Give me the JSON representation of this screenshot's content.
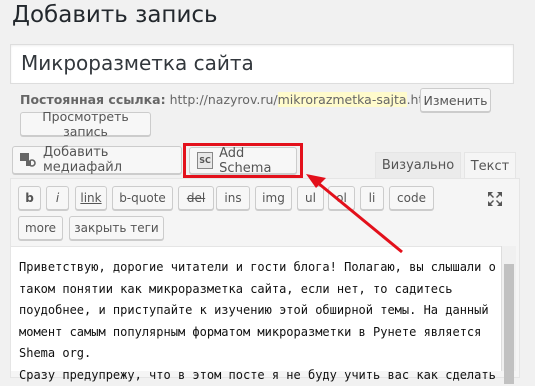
{
  "header": {
    "title": "Добавить запись"
  },
  "post": {
    "title_value": "Микроразметка сайта"
  },
  "permalink": {
    "label": "Постоянная ссылка:",
    "url_prefix": "http://nazyrov.ru/",
    "slug": "mikrorazmetka-sajta",
    "url_suffix": ".html",
    "edit_label": "Изменить",
    "view_label": "Просмотреть запись"
  },
  "media": {
    "add_media_label": "Добавить медиафайл",
    "add_schema_label": "Add Schema"
  },
  "tabs": {
    "visual": "Визуально",
    "text": "Текст"
  },
  "quicktags": [
    "b",
    "i",
    "link",
    "b-quote",
    "del",
    "ins",
    "img",
    "ul",
    "ol",
    "li",
    "code",
    "more",
    "закрыть теги"
  ],
  "editor": {
    "lines": [
      "Приветствую, дорогие читатели и гости блога! Полагаю, вы слышали о",
      "таком понятии как микроразметка сайта, если нет, то садитесь",
      "поудобнее, и приступайте к изучению этой обширной темы. На данный",
      "момент самым популярным форматом микроразметки в Рунете является",
      "Shema org.",
      "Сразу предупрежу, что в этом посте я не буду учить вас как сделать"
    ]
  },
  "colors": {
    "highlight": "#e3101b",
    "arrow": "#e3101b"
  }
}
